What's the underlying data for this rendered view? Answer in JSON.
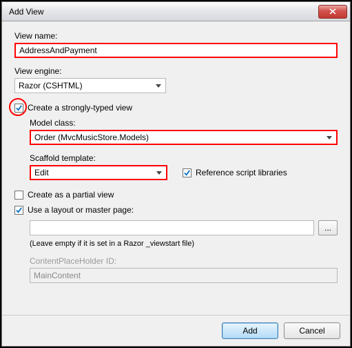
{
  "window": {
    "title": "Add View"
  },
  "viewName": {
    "label": "View name:",
    "value": "AddressAndPayment"
  },
  "viewEngine": {
    "label": "View engine:",
    "value": "Razor (CSHTML)"
  },
  "stronglyTyped": {
    "label": "Create a strongly-typed view",
    "checked": true
  },
  "modelClass": {
    "label": "Model class:",
    "value": "Order (MvcMusicStore.Models)"
  },
  "scaffold": {
    "label": "Scaffold template:",
    "value": "Edit"
  },
  "referenceScripts": {
    "label": "Reference script libraries",
    "checked": true
  },
  "partialView": {
    "label": "Create as a partial view",
    "checked": false
  },
  "useLayout": {
    "label": "Use a layout or master page:",
    "checked": true,
    "value": "",
    "hint": "(Leave empty if it is set in a Razor _viewstart file)"
  },
  "contentPlaceHolder": {
    "label": "ContentPlaceHolder ID:",
    "value": "MainContent"
  },
  "buttons": {
    "browse": "...",
    "add": "Add",
    "cancel": "Cancel"
  }
}
